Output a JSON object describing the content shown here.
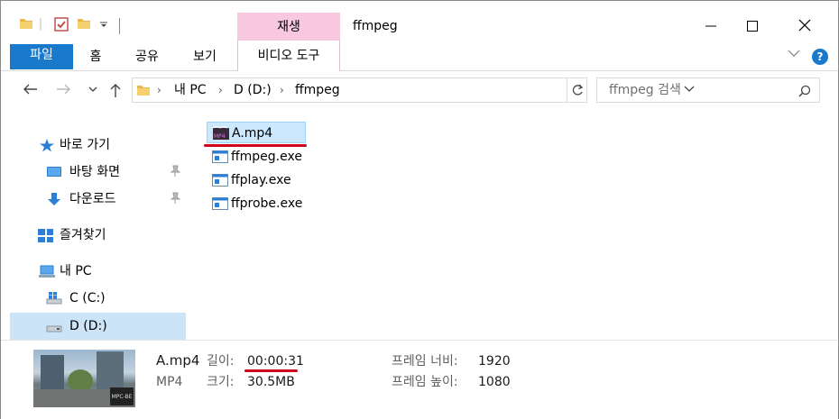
{
  "title_bar": {
    "context_tab_header": "재생",
    "window_title": "ffmpeg",
    "minimize": "—",
    "maximize": "☐",
    "close": "✕"
  },
  "ribbon": {
    "tabs": [
      "파일",
      "홈",
      "공유",
      "보기"
    ],
    "context_tab": "비디오 도구",
    "help": "?",
    "file_tab_color": "#1979ca",
    "context_color": "#f8c8e0"
  },
  "address": {
    "crumbs": [
      "내 PC",
      "D (D:)",
      "ffmpeg"
    ],
    "search_placeholder": "ffmpeg 검색"
  },
  "navpane": {
    "quick_access": "바로 가기",
    "desktop": "바탕 화면",
    "downloads": "다운로드",
    "favorites": "즐겨찾기",
    "this_pc": "내 PC",
    "drive_c": "C (C:)",
    "drive_d": "D (D:)"
  },
  "files": [
    {
      "name": "A.mp4",
      "icon": "mp4-file-icon",
      "selected": true
    },
    {
      "name": "ffmpeg.exe",
      "icon": "exe-file-icon",
      "selected": false
    },
    {
      "name": "ffplay.exe",
      "icon": "exe-file-icon",
      "selected": false
    },
    {
      "name": "ffprobe.exe",
      "icon": "exe-file-icon",
      "selected": false
    }
  ],
  "details": {
    "name": "A.mp4",
    "type": "MP4",
    "length_label": "길이:",
    "length_value": "00:00:31",
    "size_label": "크기:",
    "size_value": "30.5MB",
    "width_label": "프레임 너비:",
    "width_value": "1920",
    "height_label": "프레임 높이:",
    "height_value": "1080",
    "thumb_badge": "MPC-BE"
  },
  "highlight_color": "#d0021b"
}
